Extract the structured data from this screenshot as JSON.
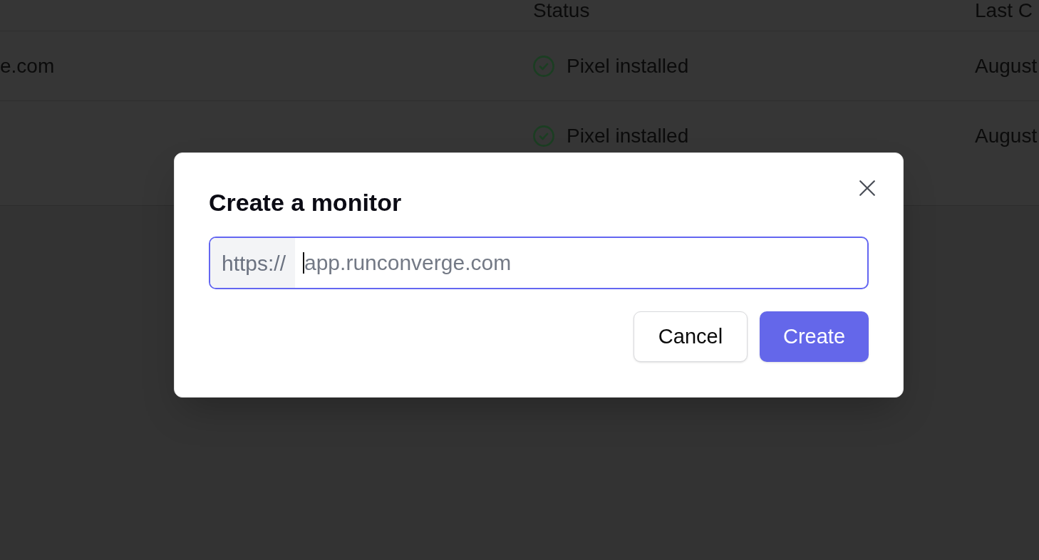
{
  "table": {
    "header": {
      "status": "Status",
      "column_3": "Last C"
    },
    "rows": [
      {
        "column_1": "e.com",
        "status": {
          "kind": "installed",
          "label": "Pixel installed"
        },
        "column_3": "August"
      },
      {
        "status": {
          "kind": "installed",
          "label": "Pixel installed"
        },
        "column_3": "August"
      }
    ]
  },
  "dialog": {
    "title": "Create a monitor",
    "url_field": {
      "prefix": "https://",
      "placeholder": "app.runconverge.com",
      "focused": true
    },
    "buttons": [
      {
        "kind": "secondary",
        "label": "Cancel"
      },
      {
        "kind": "primary",
        "label": "Create"
      }
    ]
  }
}
